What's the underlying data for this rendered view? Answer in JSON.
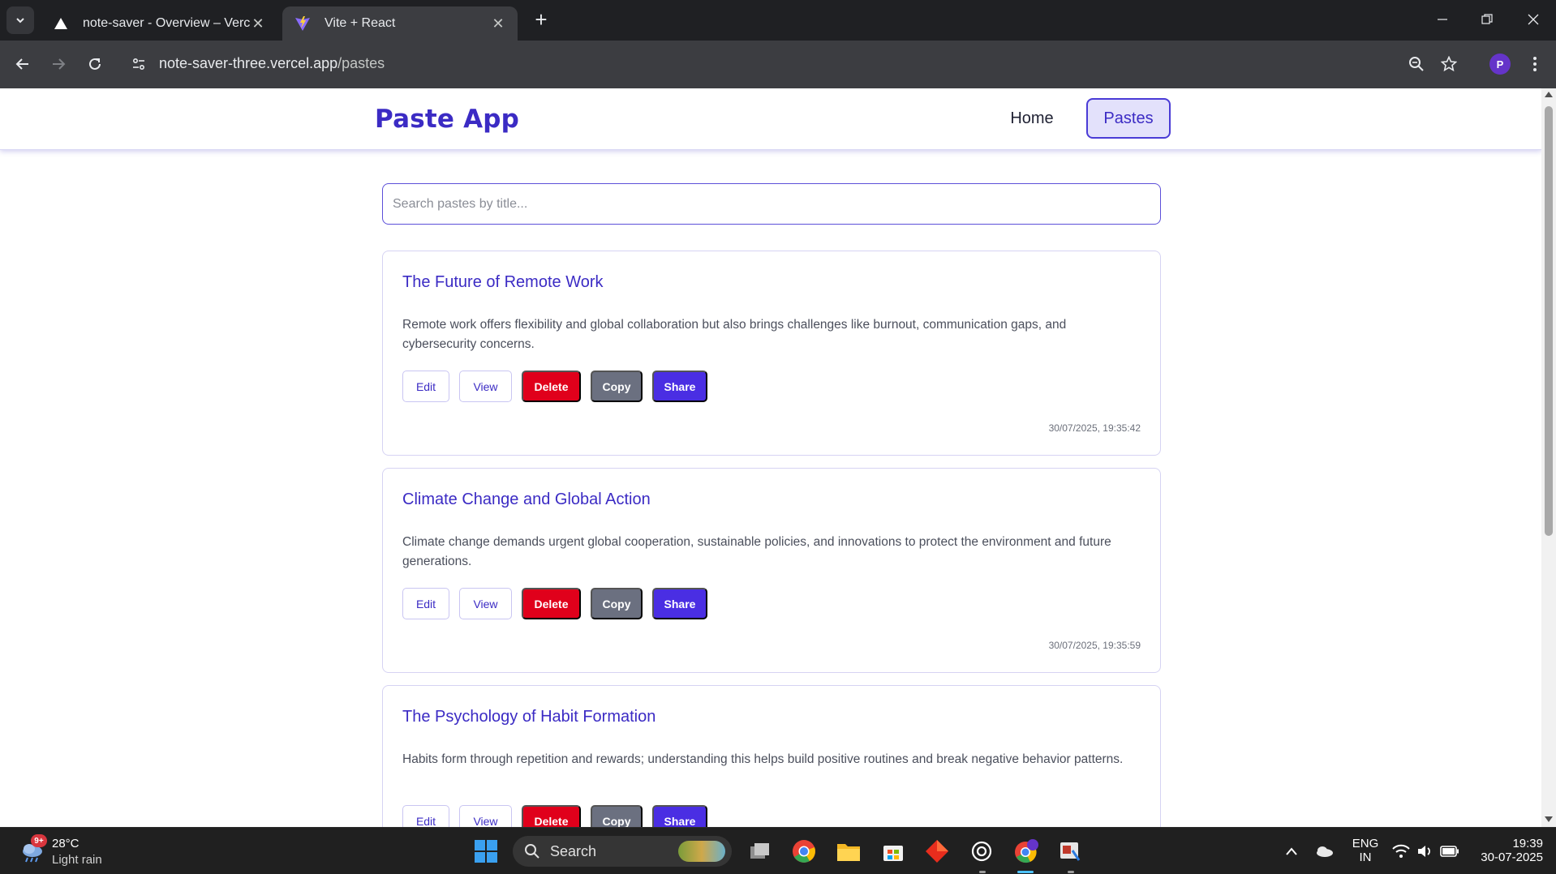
{
  "browser": {
    "tabs": [
      {
        "title": "note-saver - Overview – Vercel",
        "favicon": "vercel-triangle-icon"
      },
      {
        "title": "Vite + React",
        "favicon": "vite-icon"
      }
    ],
    "url_host": "note-saver-three.vercel.app",
    "url_path": "/pastes",
    "profile_initial": "P"
  },
  "app": {
    "brand": "Paste App",
    "nav": {
      "home": "Home",
      "pastes": "Pastes",
      "active": "Pastes"
    },
    "search_placeholder": "Search pastes by title...",
    "button_labels": {
      "edit": "Edit",
      "view": "View",
      "delete": "Delete",
      "copy": "Copy",
      "share": "Share"
    },
    "pastes": [
      {
        "title": "The Future of Remote Work",
        "content": "Remote work offers flexibility and global collaboration but also brings challenges like burnout, communication gaps, and cybersecurity concerns.",
        "date": "30/07/2025, 19:35:42"
      },
      {
        "title": "Climate Change and Global Action",
        "content": "Climate change demands urgent global cooperation, sustainable policies, and innovations to protect the environment and future generations.",
        "date": "30/07/2025, 19:35:59"
      },
      {
        "title": "The Psychology of Habit Formation",
        "content": "Habits form through repetition and rewards; understanding this helps build positive routines and break negative behavior patterns.",
        "date": ""
      }
    ]
  },
  "colors": {
    "accent": "#3b2bc4",
    "delete": "#e0001b",
    "copy": "#6b7080",
    "share": "#4a2ee3"
  },
  "taskbar": {
    "weather_badge": "9+",
    "weather_temp": "28°C",
    "weather_desc": "Light rain",
    "search_label": "Search",
    "lang_top": "ENG",
    "lang_bottom": "IN",
    "time": "19:39",
    "date": "30-07-2025"
  }
}
